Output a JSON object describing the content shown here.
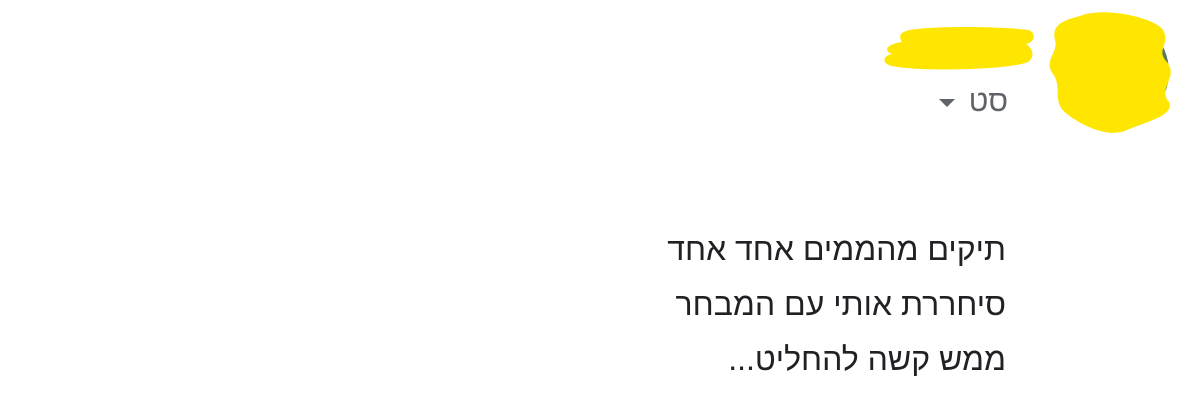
{
  "post": {
    "audience": {
      "label": "סט",
      "icon": "chevron-down-icon"
    },
    "body_lines": [
      "תיקים מהממים אחד אחד",
      "סיחררת אותי עם המבחר",
      "ממש קשה להחליט..."
    ]
  },
  "colors": {
    "redaction": "#ffe600",
    "text": "#202124",
    "secondary_text": "#5f6368",
    "background": "#ffffff"
  }
}
